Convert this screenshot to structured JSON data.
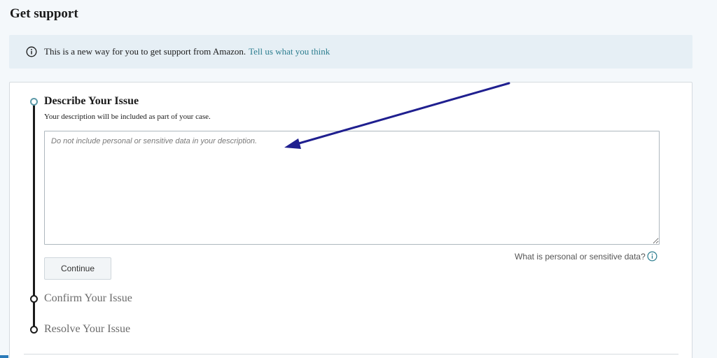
{
  "page": {
    "title": "Get support"
  },
  "banner": {
    "icon": "info-circle-icon",
    "text": "This is a new way for you to get support from Amazon.",
    "link_text": "Tell us what you think"
  },
  "steps": [
    {
      "title": "Describe Your Issue",
      "subtitle": "Your description will be included as part of your case.",
      "state": "active"
    },
    {
      "title": "Confirm Your Issue",
      "state": "inactive"
    },
    {
      "title": "Resolve Your Issue",
      "state": "inactive"
    }
  ],
  "description": {
    "value": "",
    "placeholder": "Do not include personal or sensitive data in your description."
  },
  "sensitive_help": {
    "text": "What is personal or sensitive data?",
    "icon": "info-circle-icon"
  },
  "continue_button": {
    "label": "Continue"
  },
  "colors": {
    "page_bg": "#f4f8fb",
    "banner_bg": "#e6eff5",
    "link": "#2c7d8f",
    "active_step": "#5d9aa8",
    "annotation_arrow": "#1f1f8f"
  }
}
